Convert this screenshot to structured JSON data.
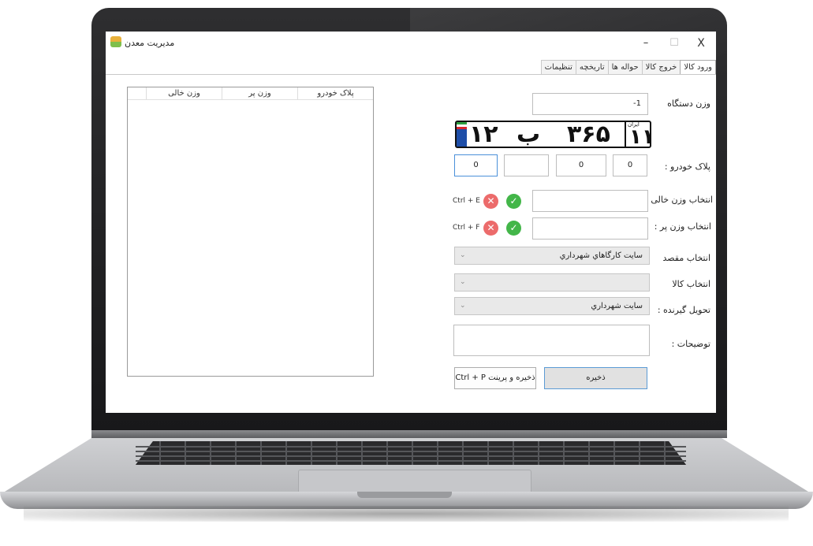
{
  "window": {
    "title": "مدیریت معدن",
    "minimize": "–",
    "maximize": "☐",
    "close": "X"
  },
  "tabs": [
    {
      "label": "ورود کالا"
    },
    {
      "label": "خروج کالا"
    },
    {
      "label": "حواله ها"
    },
    {
      "label": "تاریخچه"
    },
    {
      "label": "تنظیمات"
    }
  ],
  "list": {
    "columns": [
      "پلاک خودرو",
      "وزن پر",
      "وزن خالی"
    ]
  },
  "form": {
    "device_weight_label": "وزن دستگاه",
    "device_weight_value": "-1",
    "plate": {
      "region": "۱۱",
      "region_label": "ایران",
      "three_digits": "۳۶۵",
      "letter": "ب",
      "two_digits": "۱۲",
      "flag_text": "I.R.\nIRAN"
    },
    "plate_label": "پلاک خودرو :",
    "plate_inputs": [
      "0",
      "0",
      "",
      "0"
    ],
    "empty_weight_label": "انتخاب وزن خالی :",
    "empty_weight_hotkey": "Ctrl + E",
    "full_weight_label": "انتخاب وزن پر :",
    "full_weight_hotkey": "Ctrl + F",
    "destination_label": "انتخاب مقصد",
    "destination_value": "سايت کارگاهاي شهرداري",
    "goods_label": "انتخاب کالا",
    "goods_value": "",
    "receiver_label": "تحویل گیرنده :",
    "receiver_value": "سايت شهرداري",
    "notes_label": "توضیحات :",
    "save_button": "ذخیره",
    "save_print_button": "ذخیره و پرینت Ctrl + P"
  },
  "colors": {
    "accent": "#5b9bd5",
    "ok": "#43b649",
    "cancel": "#ec6b6b"
  }
}
